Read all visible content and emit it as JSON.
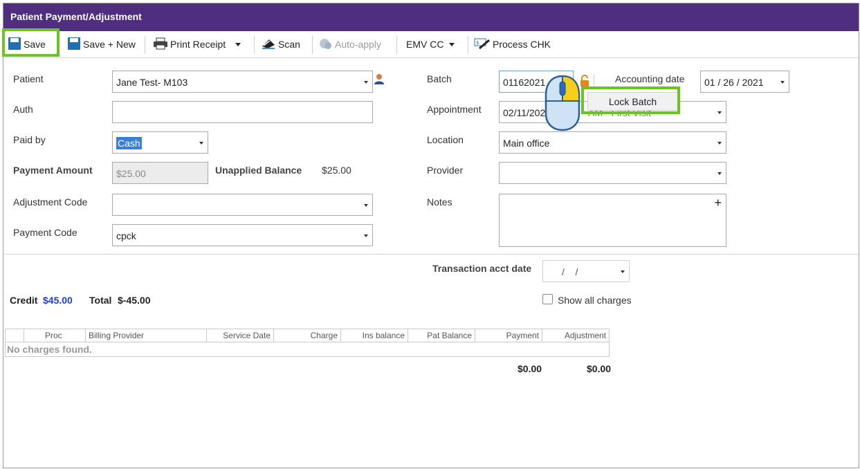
{
  "window": {
    "title": "Patient Payment/Adjustment"
  },
  "toolbar": {
    "save": "Save",
    "save_new": "Save + New",
    "print_receipt": "Print Receipt",
    "scan": "Scan",
    "auto_apply": "Auto-apply",
    "emv_cc": "EMV CC",
    "process_chk": "Process CHK"
  },
  "form": {
    "patient_label": "Patient",
    "patient_value": "Jane Test- M103",
    "auth_label": "Auth",
    "auth_value": "",
    "paid_by_label": "Paid by",
    "paid_by_value": "Cash",
    "payment_amount_label": "Payment Amount",
    "payment_amount_value": "$25.00",
    "unapplied_balance_label": "Unapplied Balance",
    "unapplied_balance_value": "$25.00",
    "adjustment_code_label": "Adjustment Code",
    "adjustment_code_value": "",
    "payment_code_label": "Payment Code",
    "payment_code_value": "cpck",
    "batch_label": "Batch",
    "batch_value": "01162021",
    "accounting_date_label": "Accounting date",
    "accounting_date_value": "01 / 26 / 2021",
    "appointment_label": "Appointment",
    "appointment_value": "02/11/202",
    "appointment_value_tail": "AM - First Visit",
    "location_label": "Location",
    "location_value": "Main office",
    "provider_label": "Provider",
    "provider_value": "",
    "notes_label": "Notes",
    "notes_add": "+",
    "transaction_acct_date_label": "Transaction acct date",
    "transaction_acct_date_value": "/    /"
  },
  "popup": {
    "lock_batch": "Lock Batch"
  },
  "summary": {
    "credit_label": "Credit",
    "credit_value": "$45.00",
    "total_label": "Total",
    "total_value": "$-45.00",
    "show_all_charges": "Show all charges"
  },
  "grid": {
    "columns": [
      "",
      "Proc",
      "Billing Provider",
      "Service Date",
      "Charge",
      "Ins balance",
      "Pat Balance",
      "Payment",
      "Adjustment"
    ],
    "empty_message": "No charges found.",
    "payment_total": "$0.00",
    "adjustment_total": "$0.00"
  },
  "colors": {
    "titlebar": "#4f2d7f",
    "highlight": "#6cc420",
    "accent_blue": "#1a3fd1"
  }
}
